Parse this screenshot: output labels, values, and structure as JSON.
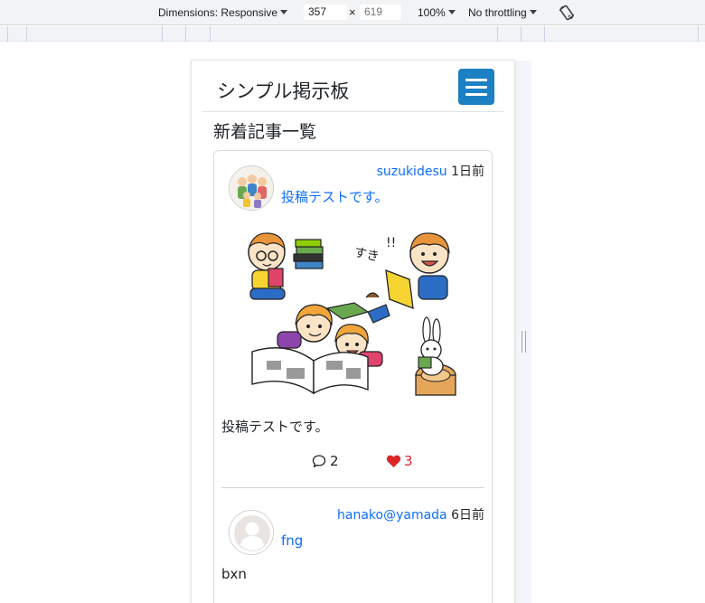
{
  "devtools": {
    "dimensions_label": "Dimensions: Responsive",
    "width": "357",
    "height_placeholder": "619",
    "times": "×",
    "zoom": "100%",
    "throttling": "No throttling",
    "rotate_icon": "rotate-icon"
  },
  "site": {
    "brand": "シンプル掲示板",
    "menu_icon": "hamburger-icon",
    "toggle_color": "#1b80c4"
  },
  "main": {
    "heading": "新着記事一覧"
  },
  "posts": [
    {
      "user": "suzukidesu",
      "ago": "1日前",
      "title": "投稿テストです。",
      "body": "投稿テストです。",
      "comments": "2",
      "likes": "3",
      "avatar": "family-avatar",
      "image": "kids-reading-illustration"
    },
    {
      "user": "hanako@yamada",
      "ago": "6日前",
      "title": "fng",
      "body": "bxn",
      "avatar": "default-user-avatar"
    }
  ],
  "colors": {
    "link": "#0d6efd",
    "like": "#dc2626"
  }
}
